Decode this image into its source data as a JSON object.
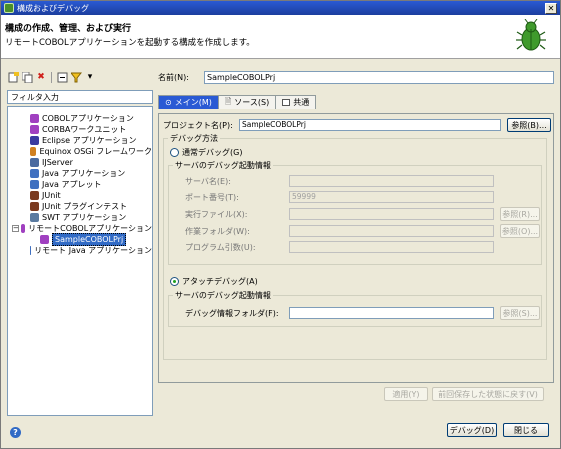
{
  "window": {
    "title": "構成およびデバッグ",
    "close_label": "✕"
  },
  "header": {
    "title": "構成の作成、管理、および実行",
    "description": "リモートCOBOLアプリケーションを起動する構成を作成します。"
  },
  "left": {
    "filter_placeholder": "フィルタ入力",
    "tree": [
      {
        "label": "COBOLアプリケーション",
        "icon": "cobol-app-icon",
        "level": 1
      },
      {
        "label": "CORBAワークユニット",
        "icon": "corba-icon",
        "level": 1
      },
      {
        "label": "Eclipse アプリケーション",
        "icon": "eclipse-icon",
        "level": 1
      },
      {
        "label": "Equinox OSGi フレームワーク",
        "icon": "osgi-icon",
        "level": 1
      },
      {
        "label": "IJServer",
        "icon": "ijserver-icon",
        "level": 1
      },
      {
        "label": "Java アプリケーション",
        "icon": "java-app-icon",
        "level": 1
      },
      {
        "label": "Java アプレット",
        "icon": "java-applet-icon",
        "level": 1
      },
      {
        "label": "JUnit",
        "icon": "junit-icon",
        "level": 1
      },
      {
        "label": "JUnit プラグインテスト",
        "icon": "junit-plugin-icon",
        "level": 1
      },
      {
        "label": "SWT アプリケーション",
        "icon": "swt-icon",
        "level": 1
      },
      {
        "label": "リモートCOBOLアプリケーション",
        "icon": "remote-cobol-icon",
        "level": 0,
        "expand": "−"
      },
      {
        "label": "SampleCOBOLPrj",
        "icon": "config-icon",
        "level": 2,
        "selected": true
      },
      {
        "label": "リモート Java アプリケーション",
        "icon": "remote-java-icon",
        "level": 1
      }
    ]
  },
  "right": {
    "name_label": "名前(N):",
    "name_value": "SampleCOBOLPrj",
    "tabs": [
      {
        "label": "メイン(M)",
        "active": true
      },
      {
        "label": "ソース(S)",
        "active": false
      },
      {
        "label": "共通",
        "active": false
      }
    ],
    "project_label": "プロジェクト名(P):",
    "project_value": "SampleCOBOLPrj",
    "browse_label": "参照(B)...",
    "debug_method_label": "デバッグ方法",
    "normal_debug_label": "通常デバッグ(G)",
    "server_group1_title": "サーバのデバッグ起動情報",
    "server_name_label": "サーバ名(E):",
    "port_label": "ポート番号(T):",
    "port_value": "59999",
    "exec_file_label": "実行ファイル(X):",
    "exec_browse_label": "参照(R)...",
    "work_folder_label": "作業フォルダ(W):",
    "work_browse_label": "参照(O)...",
    "program_args_label": "プログラム引数(U):",
    "attach_debug_label": "アタッチデバッグ(A)",
    "server_group2_title": "サーバのデバッグ起動情報",
    "debug_info_folder_label": "デバッグ情報フォルダ(F):",
    "debug_info_browse_label": "参照(S)...",
    "apply_label": "適用(Y)",
    "revert_label": "前回保存した状態に戻す(V)"
  },
  "bottom": {
    "help_label": "?",
    "debug_label": "デバッグ(D)",
    "close_label": "閉じる"
  }
}
